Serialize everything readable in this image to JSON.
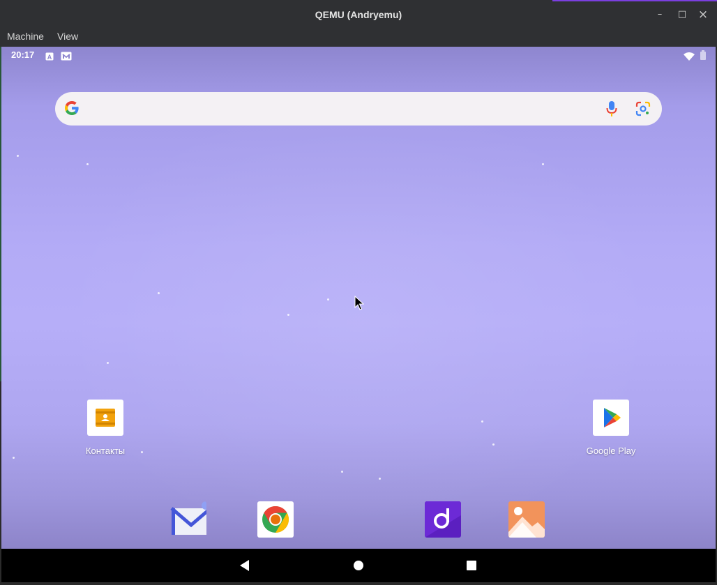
{
  "window": {
    "title": "QEMU (Andryemu)",
    "minimize_glyph": "–",
    "maximize_glyph": "□",
    "close_glyph": "×"
  },
  "menu": [
    {
      "label": "Machine"
    },
    {
      "label": "View"
    }
  ],
  "status_bar": {
    "time": "20:17",
    "notification_icons": [
      "a-keyboard-icon",
      "gmail-icon"
    ],
    "right_icons": [
      "wifi-icon",
      "battery-icon"
    ]
  },
  "search": {
    "placeholder": "",
    "icons": [
      "google-g-icon",
      "microphone-icon",
      "google-lens-icon"
    ]
  },
  "home_apps": [
    {
      "label": "Контакты",
      "icon": "contacts-icon"
    },
    {
      "label": "Google Play",
      "icon": "play-store-icon"
    }
  ],
  "dock_apps": [
    {
      "name": "email-app-icon"
    },
    {
      "name": "chrome-app-icon"
    },
    {
      "name": "music-app-icon"
    },
    {
      "name": "gallery-app-icon"
    }
  ],
  "nav_bar": [
    "back-icon",
    "home-icon",
    "recents-icon"
  ],
  "colors": {
    "wallpaper": "#b3abf6",
    "chrome_dark": "#2f3033",
    "accent": "#7b3fe0"
  }
}
